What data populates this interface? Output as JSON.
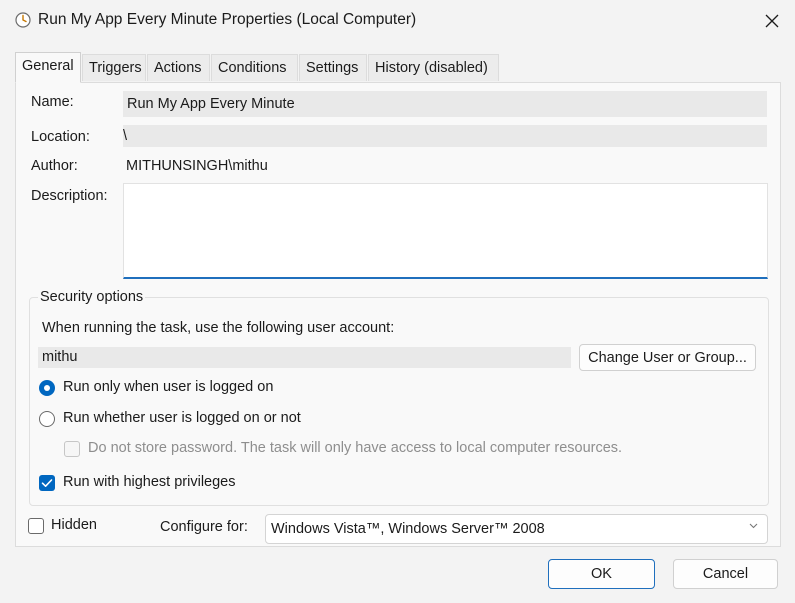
{
  "window": {
    "title": "Run My App Every Minute Properties (Local Computer)"
  },
  "tabs": [
    "General",
    "Triggers",
    "Actions",
    "Conditions",
    "Settings",
    "History (disabled)"
  ],
  "general": {
    "name_label": "Name:",
    "name_value": "Run My App Every Minute",
    "location_label": "Location:",
    "location_value": "\\",
    "author_label": "Author:",
    "author_value": "MITHUNSINGH\\mithu",
    "description_label": "Description:",
    "description_value": ""
  },
  "security": {
    "title": "Security options",
    "account_prompt": "When running the task, use the following user account:",
    "account_value": "mithu",
    "change_button": "Change User or Group...",
    "radio_logged_on": "Run only when user is logged on",
    "radio_whether": "Run whether user is logged on or not",
    "no_store_password": "Do not store password.  The task will only have access to local computer resources.",
    "highest_privileges": "Run with highest privileges",
    "selected_radio": "logged_on",
    "highest_privileges_checked": true,
    "no_store_password_checked": false
  },
  "bottom": {
    "hidden_label": "Hidden",
    "hidden_checked": false,
    "configure_label": "Configure for:",
    "configure_value": "Windows Vista™, Windows Server™ 2008"
  },
  "buttons": {
    "ok": "OK",
    "cancel": "Cancel"
  },
  "colors": {
    "accent": "#0067c0",
    "focus_border": "#1f6fbd",
    "window_bg": "#f3f3f3",
    "panel_bg": "#f9f9f9"
  },
  "icons": {
    "title": "clock-icon",
    "close": "close-icon",
    "dropdown": "chevron-down-icon",
    "check": "checkmark-icon"
  }
}
